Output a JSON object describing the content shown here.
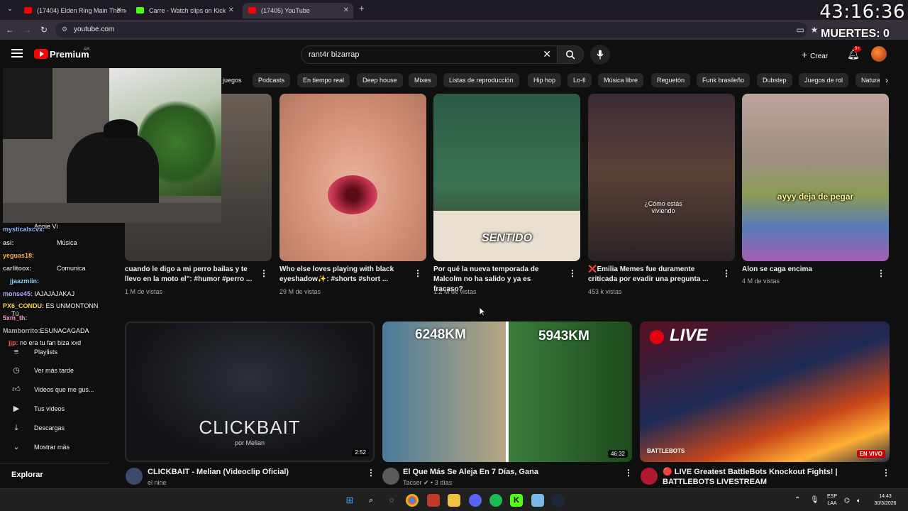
{
  "browser": {
    "tabs": [
      {
        "title": "(17404) Elden Ring Main Theme",
        "active": false
      },
      {
        "title": "Carre - Watch clips on Kick",
        "active": false
      },
      {
        "title": "(17405) YouTube",
        "active": true
      }
    ],
    "url": "youtube.com"
  },
  "overlay": {
    "clock": "43:16:36",
    "deaths": "MUERTES: 0"
  },
  "youtube": {
    "brand": "Premium",
    "region": "AR",
    "search_query": "rant4r bizarrap",
    "create_label": "Crear",
    "notif_count": "9+",
    "chips": [
      "Podcasts",
      "En tiempo real",
      "Deep house",
      "Mixes",
      "Listas de reproducción",
      "Hip hop",
      "Lo-fi",
      "Música libre",
      "Reguetón",
      "Funk brasileño",
      "Dubstep",
      "Juegos de rol",
      "Natura"
    ],
    "chip_partial_left": "juegos"
  },
  "sidebar": {
    "items": [
      {
        "icon": "playlist-icon",
        "label": "Playlists"
      },
      {
        "icon": "clock-icon",
        "label": "Ver más tarde"
      },
      {
        "icon": "thumb-up-icon",
        "label": "Videos que me gus..."
      },
      {
        "icon": "video-icon",
        "label": "Tus videos"
      },
      {
        "icon": "download-icon",
        "label": "Descargas"
      },
      {
        "icon": "chevron-down-icon",
        "label": "Mostrar más"
      }
    ],
    "explore": "Explorar"
  },
  "chat": [
    {
      "user": "",
      "text": "Annie Vi"
    },
    {
      "user": "mysticalxcvx:",
      "text": ""
    },
    {
      "user": "asi:",
      "text": "Música"
    },
    {
      "user": "yeguas18:",
      "text": ""
    },
    {
      "user": "carlitoox:",
      "text": "Comunica"
    },
    {
      "user": "jjaazmiin:",
      "text": ""
    },
    {
      "user": "monse45:",
      "text": "IAJAJAJAKAJ"
    },
    {
      "user": "PX6_CONDU:",
      "text": "ES UNMONTONN"
    },
    {
      "user": "5xm_th:",
      "text": ""
    },
    {
      "user": "Tú",
      "text": ""
    },
    {
      "user": "Mamborrito:",
      "text": "ESUNACAGADA"
    },
    {
      "user": "jjp:",
      "text": "no era tu fan biza xxd"
    }
  ],
  "shorts": [
    {
      "title": "cuando le digo a mi perro bailas y te llevo en la moto el\": #humor #perro ...",
      "views": "1 M de vistas",
      "overlay": ""
    },
    {
      "title": "Who else loves playing with black eyeshadow✨: #shorts #short ...",
      "views": "29 M de vistas",
      "overlay": ""
    },
    {
      "title": "Por qué la nueva temporada de Malcolm no ha salido y ya es fracaso?",
      "views": "1.2 M de vistas",
      "overlay": "SENTIDO"
    },
    {
      "title": "❌Emilia Memes fue duramente criticada por evadir una pregunta ...",
      "views": "453 k vistas",
      "overlay": "¿Cómo estás viviendo"
    },
    {
      "title": "Alon se caga encima",
      "views": "4 M de vistas",
      "overlay": "ayyy deja de pegar"
    }
  ],
  "videos": [
    {
      "title": "CLICKBAIT - Melian (Videoclip Oficial)",
      "channel": "el nine",
      "duration": "2:52",
      "thumb_text": "CLICKBAIT",
      "thumb_sub": "por Melian"
    },
    {
      "title": "El Que Más Se Aleja En 7 Días, Gana",
      "channel": "Tacser ✔ • 3 días",
      "duration": "46:32",
      "thumb_left": "6248KM",
      "thumb_right": "5943KM"
    },
    {
      "title": "🔴 LIVE Greatest BattleBots Knockout Fights! | BATTLEBOTS LIVESTREAM",
      "channel": "",
      "live_badge": "EN VIVO",
      "thumb_text": "LIVE",
      "thumb_logo": "BATTLEBOTS"
    }
  ],
  "taskbar": {
    "lang": "ESP",
    "lang2": "LAA",
    "time": "14:43",
    "date": "30/3/2026"
  }
}
